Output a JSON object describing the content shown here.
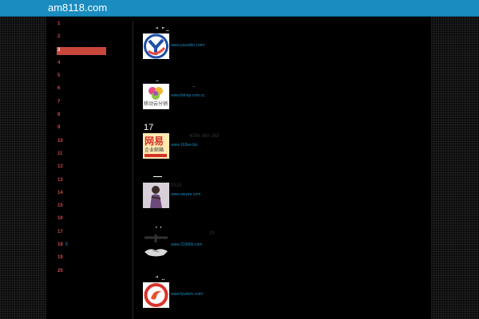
{
  "site": {
    "title": "am8118.com"
  },
  "ranks": [
    {
      "num": "1"
    },
    {
      "num": "2"
    },
    {
      "num": "3",
      "active": true
    },
    {
      "num": "4"
    },
    {
      "num": "5"
    },
    {
      "num": "6"
    },
    {
      "num": "7"
    },
    {
      "num": "8"
    },
    {
      "num": "9"
    },
    {
      "num": "10"
    },
    {
      "num": "11"
    },
    {
      "num": "12"
    },
    {
      "num": "13"
    },
    {
      "num": "14"
    },
    {
      "num": "15"
    },
    {
      "num": "16"
    },
    {
      "num": "17"
    },
    {
      "num": "18",
      "extra": "5"
    },
    {
      "num": "19"
    },
    {
      "num": "20"
    }
  ],
  "entries": [
    {
      "head": "“  ” ..",
      "url": "www.yaxuikin.com/",
      "logo": "yx-logo"
    },
    {
      "head": "..",
      "url": "www.fishop.com.cc",
      "logo": "mobile-cloud-logo",
      "logo_text": "移动云分销"
    },
    {
      "head": "17",
      "url": "www.163ee.biz",
      "phone": "4006-360-163",
      "logo": "netease-logo",
      "logo_text1": "网易",
      "logo_text2": "企业邮箱"
    },
    {
      "head": "",
      "url": "www.weyee.com",
      "small": "0315",
      "logo": "portrait-logo"
    },
    {
      "head": "'  '",
      "url": "www.31996b.com",
      "small": "29",
      "logo": "handshake-logo"
    },
    {
      "head": "“  ..",
      "url": "www.fyunkm.com/",
      "logo": "swirl-logo"
    }
  ]
}
